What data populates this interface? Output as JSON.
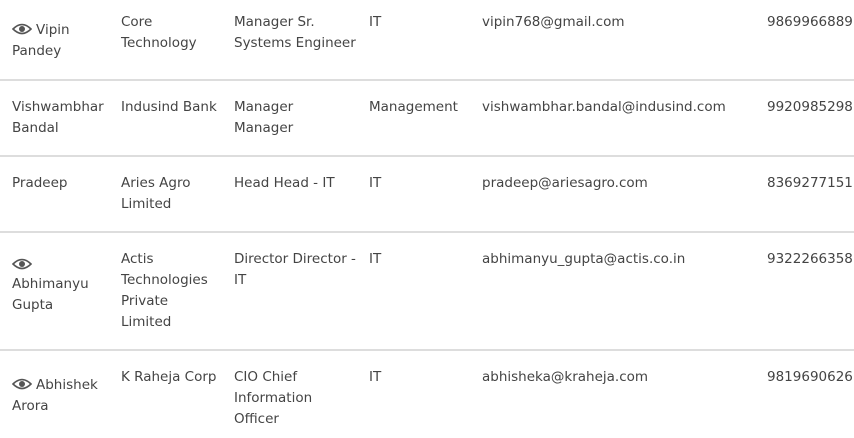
{
  "rows": [
    {
      "name_first": "Vipin",
      "name_rest": "Pandey",
      "company": "Core Technology",
      "designation": "Manager Sr. Systems Engineer",
      "department": "IT",
      "email": "vipin768@gmail.com",
      "phone": "9869966889",
      "icon": "eye-icon"
    },
    {
      "name": "Vishwambhar Bandal",
      "company": "Indusind Bank",
      "designation": "Manager Manager",
      "department": "Management",
      "email": "vishwambhar.bandal@indusind.com",
      "phone": "9920985298"
    },
    {
      "name": "Pradeep",
      "company": "Aries Agro Limited",
      "designation": "Head Head - IT",
      "department": "IT",
      "email": "pradeep@ariesagro.com",
      "phone": "8369277151"
    },
    {
      "name": "Abhimanyu Gupta",
      "company": "Actis Technologies Private Limited",
      "designation": "Director Director - IT",
      "department": "IT",
      "email": "abhimanyu_gupta@actis.co.in",
      "phone": "9322266358",
      "icon": "eye-icon"
    },
    {
      "name_first": "Abhishek",
      "name_rest": "Arora",
      "company": "K Raheja Corp",
      "designation": "CIO Chief Information Officer",
      "department": "IT",
      "email": "abhisheka@kraheja.com",
      "phone": "9819690626",
      "icon": "eye-icon"
    }
  ],
  "colors": {
    "text": "#444444",
    "divider": "#dddddd",
    "icon": "#555555"
  }
}
